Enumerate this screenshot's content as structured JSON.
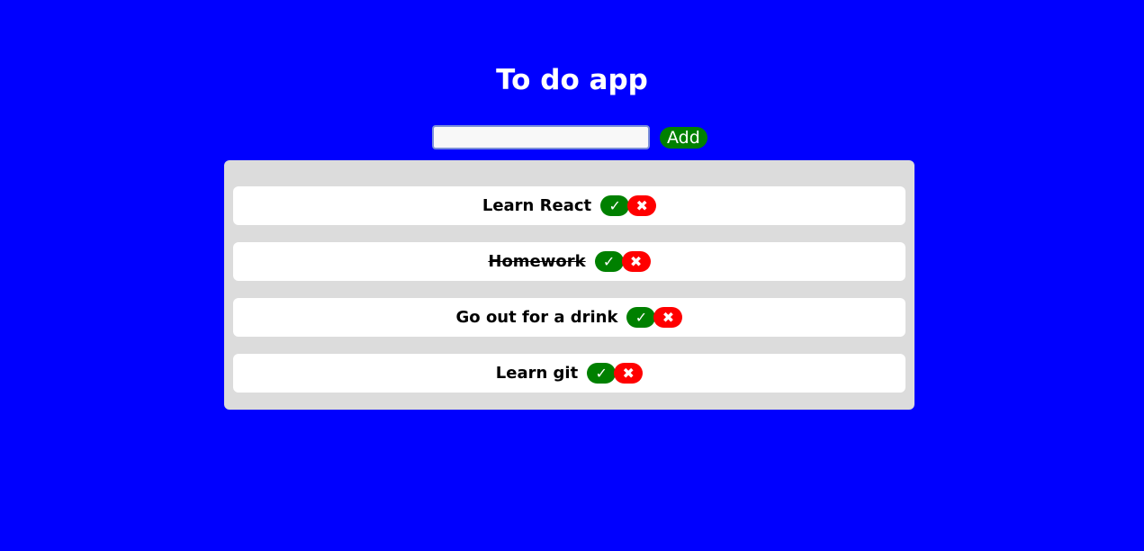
{
  "app": {
    "title": "To do app",
    "background_color": "#0000ff"
  },
  "add_form": {
    "input_value": "",
    "input_placeholder": "",
    "add_label": "Add"
  },
  "todos": [
    {
      "text": "Learn React",
      "completed": false,
      "complete_icon": "✓",
      "delete_icon": "✖"
    },
    {
      "text": "Homework",
      "completed": true,
      "complete_icon": "✓",
      "delete_icon": "✖"
    },
    {
      "text": "Go out for a drink",
      "completed": false,
      "complete_icon": "✓",
      "delete_icon": "✖"
    },
    {
      "text": "Learn git",
      "completed": false,
      "complete_icon": "✓",
      "delete_icon": "✖"
    }
  ],
  "colors": {
    "complete": "#008000",
    "delete": "#ff0000",
    "panel": "#dcdcdc"
  }
}
